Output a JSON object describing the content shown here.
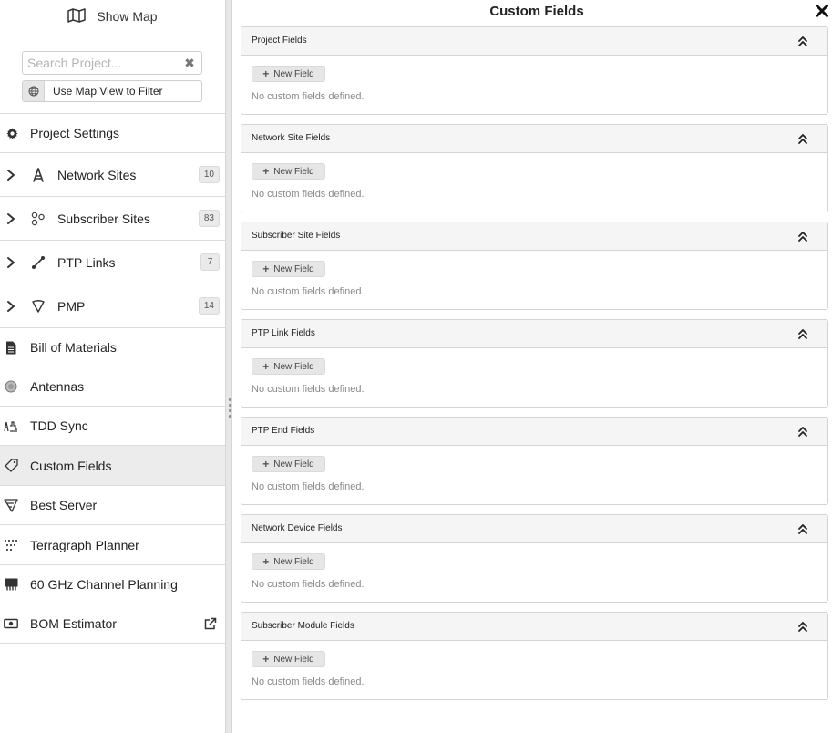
{
  "sidebar": {
    "show_map_label": "Show Map",
    "search": {
      "placeholder": "Search Project...",
      "value": ""
    },
    "map_filter_label": "Use Map View to Filter",
    "items": [
      {
        "label": "Project Settings",
        "icon": "gear-icon"
      },
      {
        "label": "Network Sites",
        "icon": "tower-icon",
        "badge": "10"
      },
      {
        "label": "Subscriber Sites",
        "icon": "subscriber-sites-icon",
        "badge": "83"
      },
      {
        "label": "PTP Links",
        "icon": "ptp-link-icon",
        "badge": "7"
      },
      {
        "label": "PMP",
        "icon": "pmp-icon",
        "badge": "14"
      },
      {
        "label": "Bill of Materials",
        "icon": "document-icon"
      },
      {
        "label": "Antennas",
        "icon": "antenna-icon"
      },
      {
        "label": "TDD Sync",
        "icon": "tdd-sync-icon"
      },
      {
        "label": "Custom Fields",
        "icon": "tag-icon"
      },
      {
        "label": "Best Server",
        "icon": "best-server-icon"
      },
      {
        "label": "Terragraph Planner",
        "icon": "terragraph-icon"
      },
      {
        "label": "60 GHz Channel Planning",
        "icon": "channel-planning-icon"
      },
      {
        "label": "BOM Estimator",
        "icon": "money-icon",
        "trailing_icon": "external-link-icon"
      }
    ],
    "active_item": "Custom Fields"
  },
  "main": {
    "title": "Custom Fields",
    "new_field_label": "New Field",
    "empty_message": "No custom fields defined.",
    "panels": [
      {
        "title": "Project Fields"
      },
      {
        "title": "Network Site Fields"
      },
      {
        "title": "Subscriber Site Fields"
      },
      {
        "title": "PTP Link Fields"
      },
      {
        "title": "PTP End Fields"
      },
      {
        "title": "Network Device Fields"
      },
      {
        "title": "Subscriber Module Fields"
      }
    ]
  },
  "colors": {
    "active_row": "#ececec",
    "panel_header": "#f5f5f5",
    "border": "#d4d4d4",
    "button_bg": "#e6e6e6",
    "muted_text": "#8a8a8a"
  }
}
